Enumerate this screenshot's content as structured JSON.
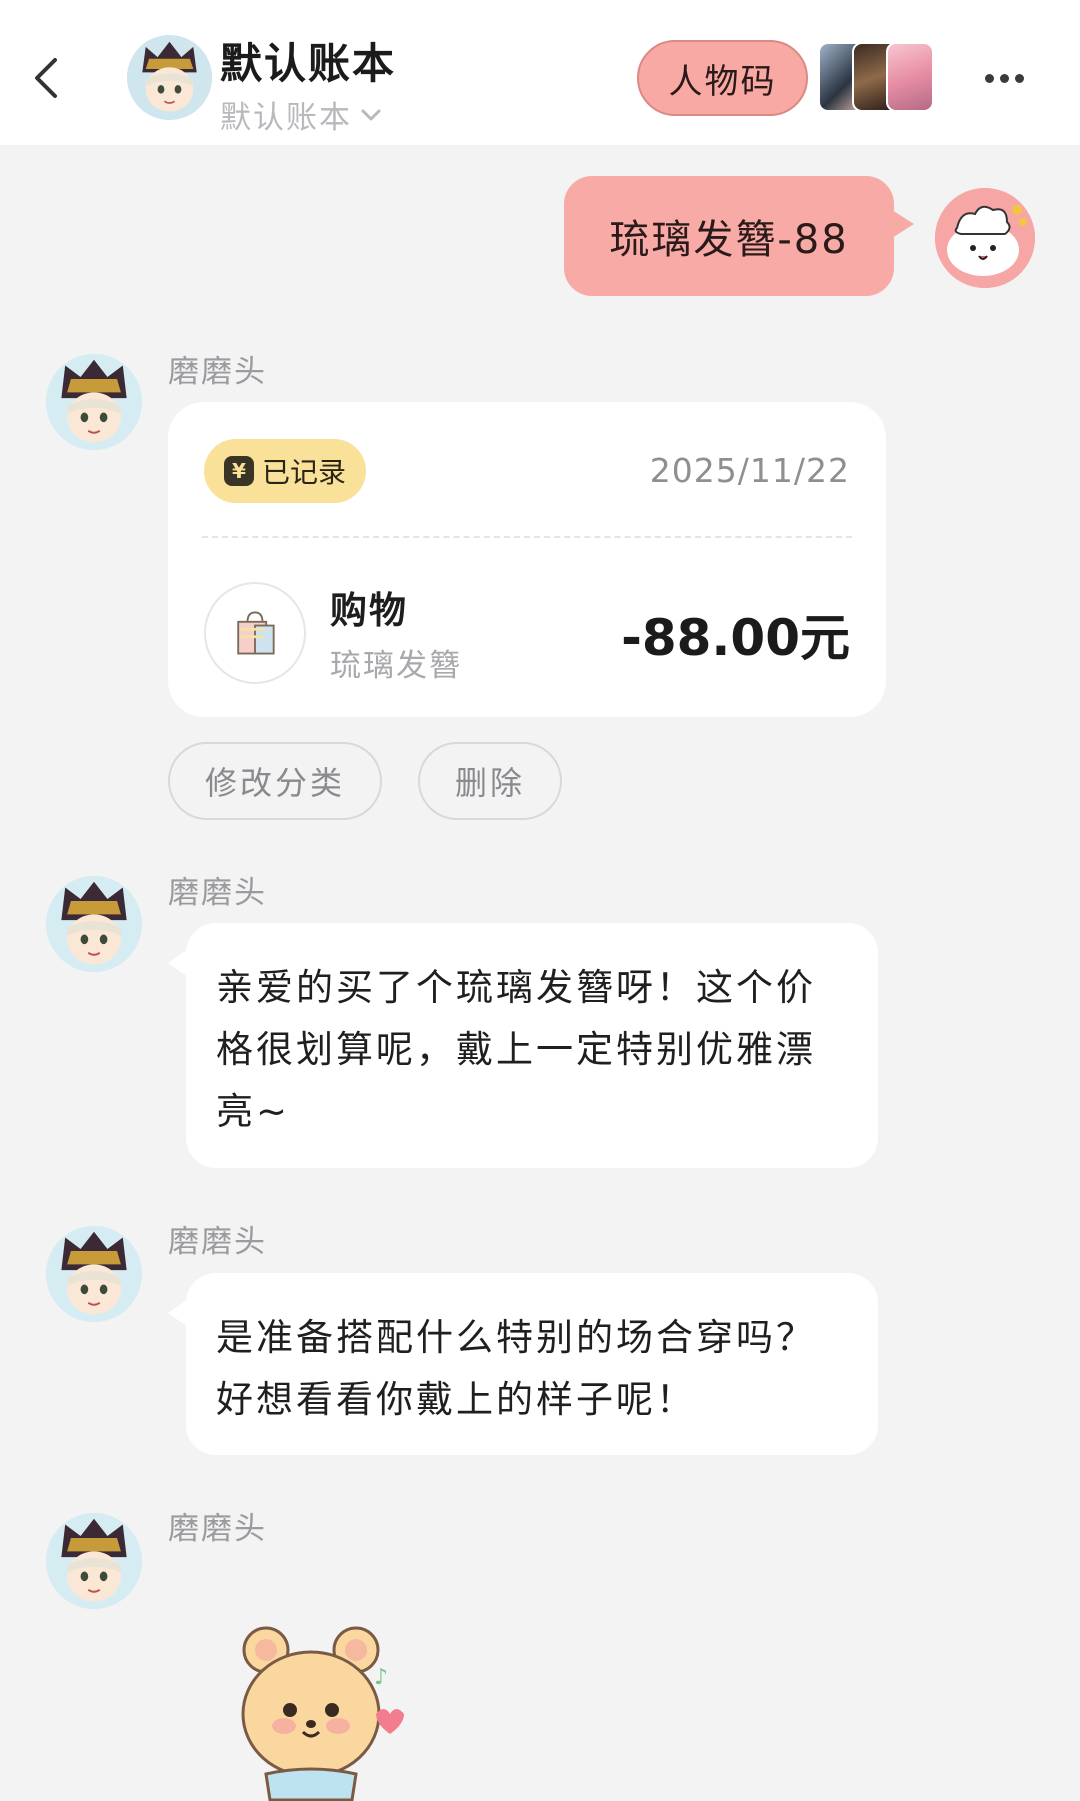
{
  "header": {
    "title": "默认账本",
    "subtitle": "默认账本",
    "character_code_label": "人物码"
  },
  "messages": {
    "user_message": "琉璃发簪-88",
    "record": {
      "sender": "磨磨头",
      "badge": "已记录",
      "badge_icon": "¥",
      "date": "2025/11/22",
      "category": "购物",
      "note": "琉璃发簪",
      "amount": "-88.00元"
    },
    "actions": {
      "edit_category": "修改分类",
      "delete": "删除"
    },
    "reply1": {
      "sender": "磨磨头",
      "text": "亲爱的买了个琉璃发簪呀！这个价格很划算呢，戴上一定特别优雅漂亮~"
    },
    "reply2": {
      "sender": "磨磨头",
      "text": "是准备搭配什么特别的场合穿吗？好想看看你戴上的样子呢！"
    },
    "reply3": {
      "sender": "磨磨头"
    }
  },
  "colors": {
    "accent_pink": "#f8aaa6",
    "badge_yellow": "#fae19a",
    "background": "#f3f3f4"
  },
  "icons": [
    "back-arrow-icon",
    "chevron-down-icon",
    "more-icon",
    "yen-icon",
    "shopping-bag-icon"
  ]
}
